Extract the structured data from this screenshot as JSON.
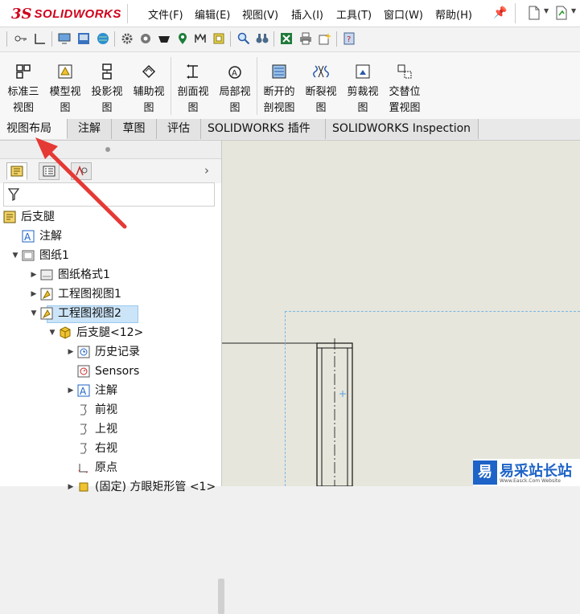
{
  "app": {
    "logo_mark": "3S",
    "logo_text": "SOLIDWORKS"
  },
  "menu": {
    "items": [
      "文件(F)",
      "编辑(E)",
      "视图(V)",
      "插入(I)",
      "工具(T)",
      "窗口(W)",
      "帮助(H)"
    ],
    "pin_icon": "pin-icon"
  },
  "ribbon": {
    "buttons": [
      {
        "line1": "标准三",
        "line2": "视图",
        "icon": "standard-3view-icon"
      },
      {
        "line1": "模型视",
        "line2": "图",
        "icon": "model-view-icon"
      },
      {
        "line1": "投影视",
        "line2": "图",
        "icon": "projected-view-icon"
      },
      {
        "line1": "辅助视",
        "line2": "图",
        "icon": "auxiliary-view-icon"
      },
      {
        "line1": "剖面视",
        "line2": "图",
        "icon": "section-view-icon"
      },
      {
        "line1": "局部视",
        "line2": "图",
        "icon": "detail-view-icon"
      },
      {
        "line1": "断开的",
        "line2": "剖视图",
        "icon": "broken-out-section-icon"
      },
      {
        "line1": "断裂视",
        "line2": "图",
        "icon": "break-view-icon"
      },
      {
        "line1": "剪裁视",
        "line2": "图",
        "icon": "crop-view-icon"
      },
      {
        "line1": "交替位",
        "line2": "置视图",
        "icon": "alternate-position-icon"
      }
    ]
  },
  "tabs": [
    "视图布局",
    "注解",
    "草图",
    "评估",
    "SOLIDWORKS 插件",
    "SOLIDWORKS Inspection"
  ],
  "tree": [
    {
      "label": "后支腿",
      "level": 0,
      "arrow": "",
      "icon": "drawing-icon"
    },
    {
      "label": "注解",
      "level": 1,
      "arrow": "",
      "icon": "annotation-icon"
    },
    {
      "label": "图纸1",
      "level": 1,
      "arrow": "▼",
      "icon": "sheet-icon"
    },
    {
      "label": "图纸格式1",
      "level": 2,
      "arrow": "▶",
      "icon": "sheet-format-icon"
    },
    {
      "label": "工程图视图1",
      "level": 2,
      "arrow": "▶",
      "icon": "drawing-view-icon"
    },
    {
      "label": "工程图视图2",
      "level": 2,
      "arrow": "▼",
      "icon": "drawing-view-icon",
      "selected": true
    },
    {
      "label": "后支腿<12>",
      "level": 3,
      "arrow": "▼",
      "icon": "part-icon"
    },
    {
      "label": "历史记录",
      "level": 4,
      "arrow": "▶",
      "icon": "history-icon"
    },
    {
      "label": "Sensors",
      "level": 4,
      "arrow": "",
      "icon": "sensors-icon"
    },
    {
      "label": "注解",
      "level": 4,
      "arrow": "▶",
      "icon": "annotation-icon"
    },
    {
      "label": "前视",
      "level": 4,
      "arrow": "",
      "icon": "plane-icon"
    },
    {
      "label": "上视",
      "level": 4,
      "arrow": "",
      "icon": "plane-icon"
    },
    {
      "label": "右视",
      "level": 4,
      "arrow": "",
      "icon": "plane-icon"
    },
    {
      "label": "原点",
      "level": 4,
      "arrow": "",
      "icon": "origin-icon"
    },
    {
      "label": "(固定) 方眼矩形管 <1>",
      "level": 4,
      "arrow": "▶",
      "icon": "weldment-icon"
    }
  ],
  "watermark": {
    "logo": "易",
    "text": "易采站长站",
    "url": "Www.Easck.Com  Website"
  },
  "colors": {
    "accent": "#1e63c7",
    "brand_red": "#d0021b",
    "selection": "#cce4f7",
    "canvas": "#e6e6dc",
    "annotation_arrow": "#e53935"
  }
}
